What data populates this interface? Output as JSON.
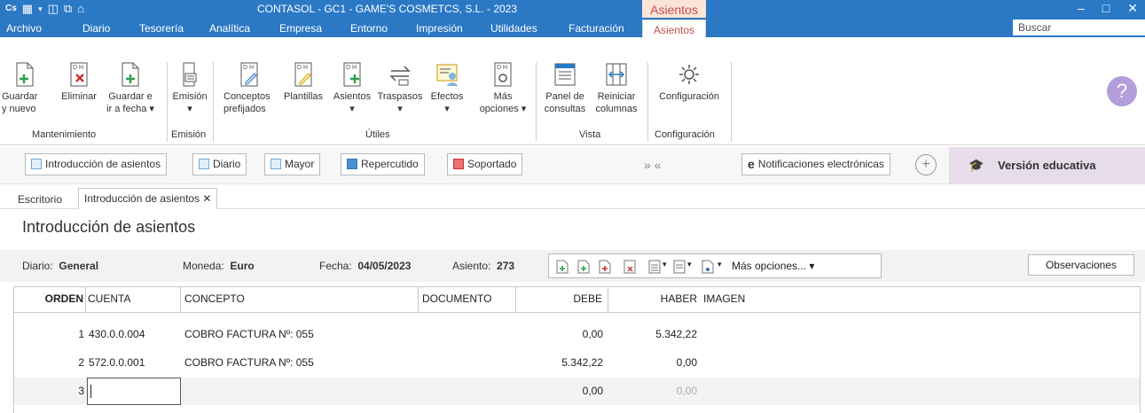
{
  "titlebar": {
    "title": "CONTASOL - GC1 - GAME'S COSMETCS, S.L. - 2023",
    "context_tab": "Asientos",
    "minimize": "–",
    "maximize": "□",
    "close": "✕"
  },
  "menu": {
    "items": [
      "Archivo",
      "Diario",
      "Tesorería",
      "Analítica",
      "Empresa",
      "Entorno",
      "Impresión",
      "Utilidades",
      "Facturación"
    ],
    "active": "Asientos",
    "search_placeholder": "Buscar"
  },
  "ribbon": {
    "buttons": [
      {
        "line1": "Guardar",
        "line2": "y nuevo",
        "icon": "document-add-icon"
      },
      {
        "line1": "Eliminar",
        "line2": "",
        "icon": "document-delete-icon"
      },
      {
        "line1": "Guardar e",
        "line2": "ir a fecha ▾",
        "icon": "document-goto-icon"
      },
      {
        "line1": "Emisión",
        "line2": "▾",
        "icon": "print-icon"
      },
      {
        "line1": "Conceptos",
        "line2": "prefijados",
        "icon": "predefined-concepts-icon"
      },
      {
        "line1": "Plantillas",
        "line2": "",
        "icon": "templates-icon"
      },
      {
        "line1": "Asientos",
        "line2": "▾",
        "icon": "entries-icon"
      },
      {
        "line1": "Traspasos",
        "line2": "▾",
        "icon": "transfer-icon"
      },
      {
        "line1": "Efectos",
        "line2": "▾",
        "icon": "effects-icon"
      },
      {
        "line1": "Más",
        "line2": "opciones ▾",
        "icon": "more-options-icon"
      },
      {
        "line1": "Panel de",
        "line2": "consultas",
        "icon": "query-panel-icon"
      },
      {
        "line1": "Reiniciar",
        "line2": "columnas",
        "icon": "reset-columns-icon"
      },
      {
        "line1": "Configuración",
        "line2": "",
        "icon": "gear-icon"
      }
    ],
    "groups": [
      "Mantenimiento",
      "Emisión",
      "Útiles",
      "Vista",
      "Configuración"
    ],
    "help": "?"
  },
  "toolbar": {
    "buttons": [
      "Introducción de asientos",
      "Diario",
      "Mayor",
      "Repercutido",
      "Soportado"
    ],
    "nav": "»  «",
    "notifications": "Notificaciones electrónicas",
    "add": "+",
    "edu": "Versión educativa"
  },
  "tabs": [
    "Escritorio",
    "Introducción de asientos ✕"
  ],
  "page_title": "Introducción de asientos",
  "header": {
    "diario_label": "Diario:",
    "diario_value": "General",
    "moneda_label": "Moneda:",
    "moneda_value": "Euro",
    "fecha_label": "Fecha:",
    "fecha_value": "04/05/2023",
    "asiento_label": "Asiento:",
    "asiento_value": "273",
    "more_options": "Más opciones... ▾",
    "observaciones": "Observaciones"
  },
  "grid": {
    "columns": [
      "ORDEN",
      "CUENTA",
      "CONCEPTO",
      "DOCUMENTO",
      "DEBE",
      "HABER",
      "IMAGEN"
    ],
    "rows": [
      {
        "orden": "1",
        "cuenta": "430.0.0.004",
        "concepto": "COBRO FACTURA Nº: 055",
        "documento": "",
        "debe": "0,00",
        "haber": "5.342,22"
      },
      {
        "orden": "2",
        "cuenta": "572.0.0.001",
        "concepto": "COBRO FACTURA Nº: 055",
        "documento": "",
        "debe": "5.342,22",
        "haber": "0,00"
      },
      {
        "orden": "3",
        "cuenta": "",
        "concepto": "",
        "documento": "",
        "debe": "0,00",
        "haber": "0,00"
      }
    ]
  }
}
